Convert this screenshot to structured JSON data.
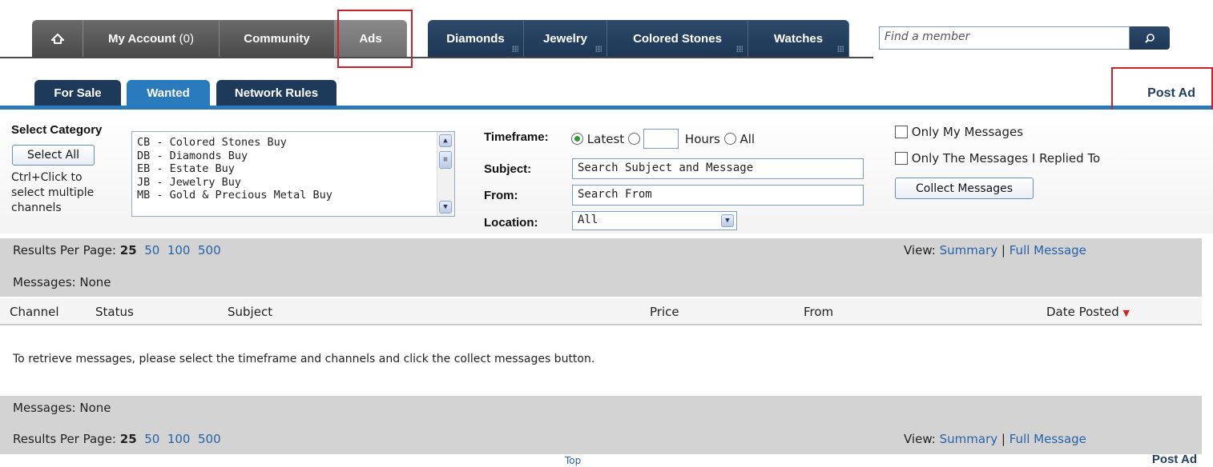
{
  "nav": {
    "home_icon": "home-icon",
    "my_account": "My Account",
    "my_account_count": "(0)",
    "community": "Community",
    "ads": "Ads",
    "diamonds": "Diamonds",
    "jewelry": "Jewelry",
    "colored_stones": "Colored Stones",
    "watches": "Watches",
    "search_placeholder": "Find a member",
    "search_icon": "search-icon"
  },
  "subtabs": {
    "for_sale": "For Sale",
    "wanted": "Wanted",
    "network_rules": "Network Rules",
    "post_ad": "Post Ad"
  },
  "filters": {
    "select_category": "Select Category",
    "select_all": "Select All",
    "help_line1": "Ctrl+Click to",
    "help_line2": "select multiple",
    "help_line3": "channels",
    "categories": [
      "CB - Colored Stones Buy",
      "DB - Diamonds Buy",
      "EB - Estate Buy",
      "JB - Jewelry Buy",
      "MB - Gold & Precious Metal Buy"
    ],
    "timeframe_label": "Timeframe:",
    "latest": "Latest",
    "hours": "Hours",
    "all": "All",
    "subject_label": "Subject:",
    "subject_value": "Search Subject and Message",
    "from_label": "From:",
    "from_value": "Search From",
    "location_label": "Location:",
    "location_value": "All",
    "only_my": "Only My Messages",
    "only_replied": "Only The Messages I Replied To",
    "collect": "Collect Messages"
  },
  "results": {
    "per_page_label": "Results Per Page:",
    "options": [
      "25",
      "50",
      "100",
      "500"
    ],
    "view_label": "View:",
    "summary": "Summary",
    "separator": "|",
    "full_message": "Full Message",
    "messages": "Messages: None"
  },
  "columns": {
    "channel": "Channel",
    "status": "Status",
    "subject": "Subject",
    "price": "Price",
    "from": "From",
    "date_posted": "Date Posted"
  },
  "info": "To retrieve messages, please select the timeframe and channels and click the collect messages button.",
  "footer": {
    "top": "Top",
    "post_ad": "Post Ad"
  },
  "colors": {
    "nav_dark": "#4a4a4a",
    "nav_blue": "#1d3654",
    "accent_blue": "#2a79b8",
    "highlight_red": "#c8222a",
    "link": "#2563a7"
  }
}
